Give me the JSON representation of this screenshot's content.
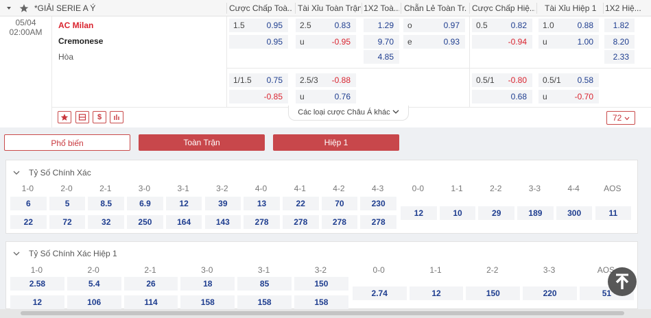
{
  "header": {
    "league": "*GIẢI SERIE A Ý",
    "columns": [
      "Cược Chấp Toà...",
      "Tài Xỉu Toàn Trận",
      "1X2 Toà...",
      "Chẵn Lẻ Toàn Tr...",
      "Cược Chấp Hiệ...",
      "Tài Xỉu Hiệp 1",
      "1X2 Hiệ..."
    ]
  },
  "match": {
    "date": "05/04",
    "time": "02:00AM",
    "home": "AC Milan",
    "away": "Cremonese",
    "draw": "Hòa",
    "other_markets": "Các loại cược Châu Á khác",
    "more_count": "72",
    "odds": {
      "hcap_ft": [
        [
          "1.5",
          "0.95"
        ],
        [
          "",
          "0.95"
        ],
        [
          "1/1.5",
          "0.75"
        ],
        [
          "",
          "-0.85"
        ]
      ],
      "ou_ft": [
        [
          "2.5",
          "0.83"
        ],
        [
          "u",
          "-0.95"
        ],
        [
          "2.5/3",
          "-0.88"
        ],
        [
          "u",
          "0.76"
        ]
      ],
      "x12_ft": [
        "1.29",
        "9.70",
        "4.85"
      ],
      "oe_ft": [
        [
          "o",
          "0.97"
        ],
        [
          "e",
          "0.93"
        ]
      ],
      "hcap_h1": [
        [
          "0.5",
          "0.82"
        ],
        [
          "",
          "-0.94"
        ],
        [
          "0.5/1",
          "-0.80"
        ],
        [
          "",
          "0.68"
        ]
      ],
      "ou_h1": [
        [
          "1.0",
          "0.88"
        ],
        [
          "u",
          "1.00"
        ],
        [
          "0.5/1",
          "0.58"
        ],
        [
          "u",
          "-0.70"
        ]
      ],
      "x12_h1": [
        "1.82",
        "8.20",
        "2.33"
      ]
    }
  },
  "tabs": [
    "Phổ biến",
    "Toàn Trận",
    "Hiệp 1"
  ],
  "correct_score": {
    "title": "Tỷ Số Chính Xác",
    "pairs": [
      {
        "label": "1-0",
        "a": "6",
        "b": "22"
      },
      {
        "label": "2-0",
        "a": "5",
        "b": "72"
      },
      {
        "label": "2-1",
        "a": "8.5",
        "b": "32"
      },
      {
        "label": "3-0",
        "a": "6.9",
        "b": "250"
      },
      {
        "label": "3-1",
        "a": "12",
        "b": "164"
      },
      {
        "label": "3-2",
        "a": "39",
        "b": "143"
      },
      {
        "label": "4-0",
        "a": "13",
        "b": "278"
      },
      {
        "label": "4-1",
        "a": "22",
        "b": "278"
      },
      {
        "label": "4-2",
        "a": "70",
        "b": "278"
      },
      {
        "label": "4-3",
        "a": "230",
        "b": "278"
      }
    ],
    "singles": [
      {
        "label": "0-0",
        "v": "12"
      },
      {
        "label": "1-1",
        "v": "10"
      },
      {
        "label": "2-2",
        "v": "29"
      },
      {
        "label": "3-3",
        "v": "189"
      },
      {
        "label": "4-4",
        "v": "300"
      },
      {
        "label": "AOS",
        "v": "11"
      }
    ]
  },
  "correct_score_h1": {
    "title": "Tỷ Số Chính Xác Hiệp 1",
    "pairs": [
      {
        "label": "1-0",
        "a": "2.58",
        "b": "12"
      },
      {
        "label": "2-0",
        "a": "5.4",
        "b": "106"
      },
      {
        "label": "2-1",
        "a": "26",
        "b": "114"
      },
      {
        "label": "3-0",
        "a": "18",
        "b": "158"
      },
      {
        "label": "3-1",
        "a": "85",
        "b": "158"
      },
      {
        "label": "3-2",
        "a": "150",
        "b": "158"
      }
    ],
    "singles": [
      {
        "label": "0-0",
        "v": "2.74"
      },
      {
        "label": "1-1",
        "v": "12"
      },
      {
        "label": "2-2",
        "v": "150"
      },
      {
        "label": "3-3",
        "v": "220"
      },
      {
        "label": "AOS",
        "v": "51"
      }
    ]
  },
  "colors": {
    "accent": "#c8474b",
    "home": "#d9232e",
    "odds": "#1e3d8f",
    "negative": "#d9232e"
  }
}
